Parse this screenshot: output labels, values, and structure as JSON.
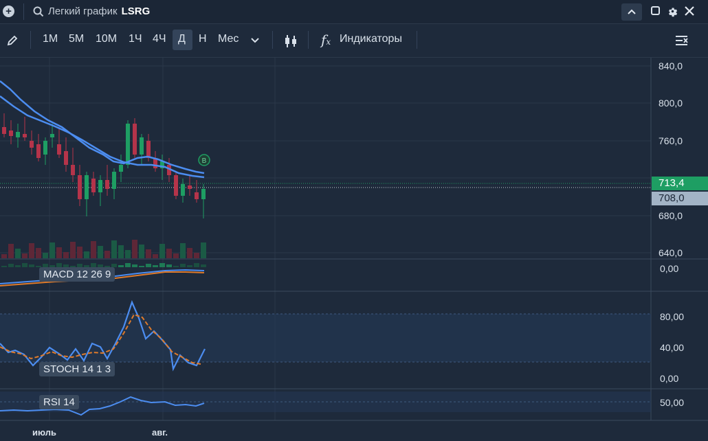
{
  "topbar": {
    "title": "Легкий график",
    "ticker": "LSRG",
    "add_icon": "plus-circle-icon",
    "search_icon": "search-icon",
    "collapse_icon": "chevron-up-icon",
    "window_icon": "square-icon",
    "settings_icon": "gear-icon",
    "close_icon": "close-icon"
  },
  "toolbar": {
    "draw_icon": "pencil-icon",
    "timeframes": [
      "1М",
      "5М",
      "10М",
      "1Ч",
      "4Ч",
      "Д",
      "Н",
      "Мес"
    ],
    "active_timeframe": "Д",
    "more_icon": "chevron-down-icon",
    "chart_type_icon": "candles-icon",
    "indicators_icon": "fx-icon",
    "indicators_label": "Индикаторы",
    "collapse_icon": "collapse-lines-icon"
  },
  "price_axis": {
    "ticks": [
      "840,0",
      "800,0",
      "760,0",
      "680,0",
      "640,0"
    ],
    "last_price": "713,4",
    "cursor_price": "708,0",
    "last_price_color": "#1e9e63",
    "cursor_price_color": "#a3b4c6"
  },
  "indicators": {
    "macd_label": "MACD 12 26 9",
    "macd_ticks": [
      "0,00"
    ],
    "stoch_label": "STOCH 14 1 3",
    "stoch_ticks": [
      "80,00",
      "40,00",
      "0,00"
    ],
    "rsi_label": "RSI 14",
    "rsi_ticks": [
      "50,00"
    ]
  },
  "time_axis": {
    "labels": [
      "июль",
      "авг."
    ]
  },
  "chart_marker": "B",
  "colors": {
    "up": "#1e9e63",
    "down": "#b5344a",
    "ma": "#4c8df0",
    "signal": "#e07b2a"
  }
}
